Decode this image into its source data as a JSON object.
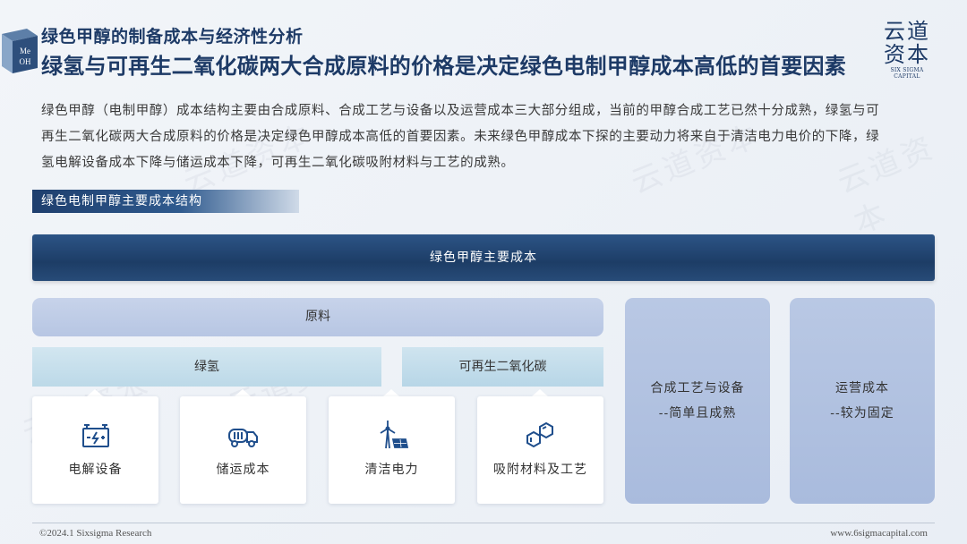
{
  "header": {
    "cube_text": [
      "Me",
      "OH"
    ],
    "subtitle": "绿色甲醇的制备成本与经济性分析",
    "title": "绿氢与可再生二氧化碳两大合成原料的价格是决定绿色电制甲醇成本高低的首要因素",
    "logo_top": "云道",
    "logo_bottom": "资本",
    "logo_en": "SIX SIGMA CAPITAL"
  },
  "paragraph": [
    "绿色甲醇（电制甲醇）成本结构主要由合成原料、合成工艺与设备以及运营成本三大部分组成，当前的甲醇合成工艺已然十分成熟，绿氢与可",
    "再生二氧化碳两大合成原料的价格是决定绿色甲醇成本高低的首要因素。未来绿色甲醇成本下探的主要动力将来自于清洁电力电价的下降，绿",
    "氢电解设备成本下降与储运成本下降，可再生二氧化碳吸附材料与工艺的成熟。"
  ],
  "section_tag": "绿色电制甲醇主要成本结构",
  "diagram": {
    "banner": "绿色甲醇主要成本",
    "raw": "原料",
    "hydrogen": "绿氢",
    "co2": "可再生二氧化碳",
    "cards": [
      {
        "label": "电解设备",
        "icon": "battery-icon"
      },
      {
        "label": "储运成本",
        "icon": "tanker-truck-icon"
      },
      {
        "label": "清洁电力",
        "icon": "wind-solar-icon"
      },
      {
        "label": "吸附材料及工艺",
        "icon": "molecule-icon"
      }
    ],
    "process": {
      "line1": "合成工艺与设备",
      "line2": "--简单且成熟"
    },
    "operation": {
      "line1": "运营成本",
      "line2": "--较为固定"
    }
  },
  "footer": {
    "left": "©2024.1 Sixsigma Research",
    "right": "www.6sigmacapital.com"
  },
  "colors": {
    "navy": "#1d3a66",
    "banner": "#1f3f6e",
    "icon_blue": "#1f4e8c"
  }
}
